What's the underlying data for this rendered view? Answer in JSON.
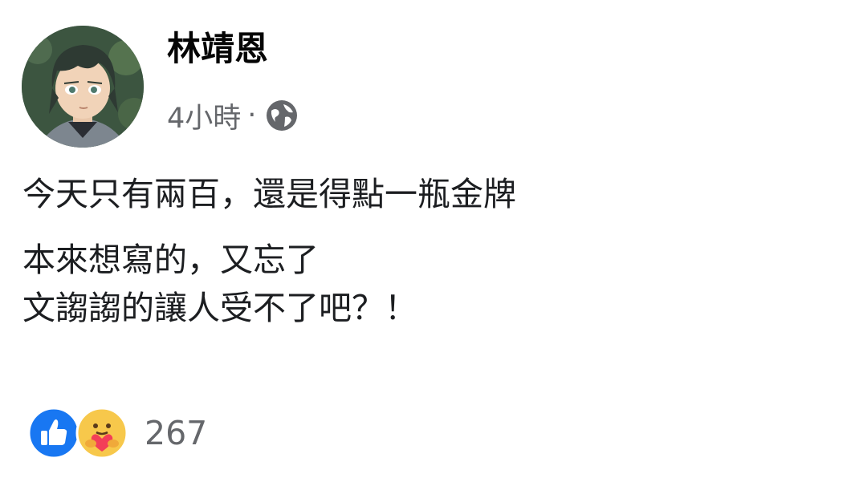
{
  "post": {
    "author": "林靖恩",
    "timestamp": "4小時",
    "separator": "·",
    "privacy_icon": "globe-icon",
    "paragraphs": [
      [
        "今天只有兩百，還是得點一瓶金牌"
      ],
      [
        "本來想寫的，又忘了",
        "文謅謅的讓人受不了吧？！"
      ]
    ],
    "reactions": {
      "icons": [
        "like-icon",
        "care-icon"
      ],
      "count": "267"
    }
  },
  "colors": {
    "like_blue": "#1877f2",
    "care_yellow": "#f7c84b",
    "secondary_text": "#65676b"
  }
}
